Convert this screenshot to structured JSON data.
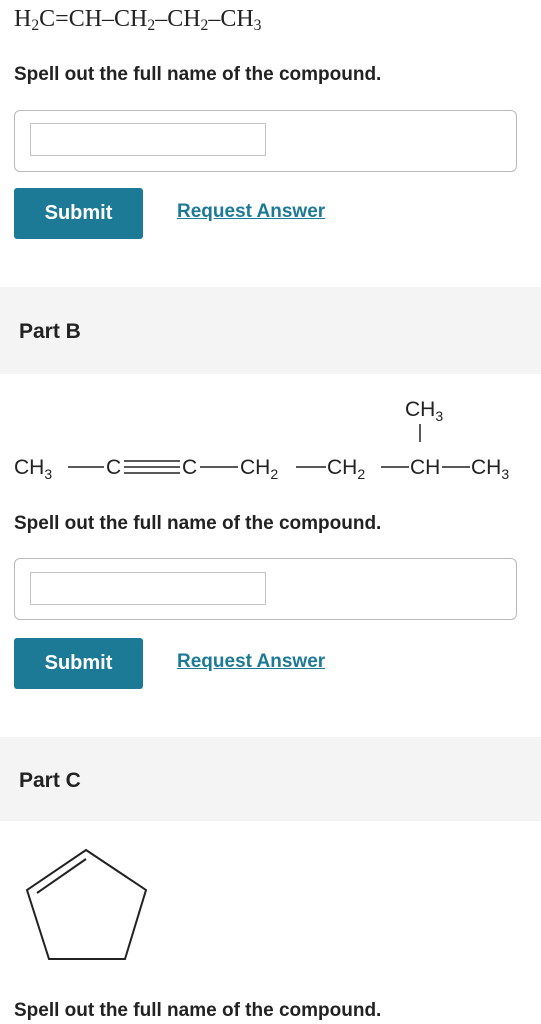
{
  "part_a": {
    "formula": {
      "h2": "H",
      "h2_sub": "2",
      "c": "C",
      "eq": "=",
      "ch": "CH",
      "dash1": "–",
      "ch2a": "CH",
      "ch2a_sub": "2",
      "dash2": "–",
      "ch2b": "CH",
      "ch2b_sub": "2",
      "dash3": "–",
      "ch3": "CH",
      "ch3_sub": "3"
    },
    "prompt": "Spell out the full name of the compound.",
    "input_value": "",
    "submit_label": "Submit",
    "request_label": "Request Answer"
  },
  "part_b": {
    "title": "Part B",
    "structure": {
      "branch_ch": "CH",
      "branch_sub": "3",
      "c1": "CH",
      "c1_sub": "3",
      "c2": "C",
      "c3": "C",
      "c4": "CH",
      "c4_sub": "2",
      "c5": "CH",
      "c5_sub": "2",
      "c6": "CH",
      "c7": "CH",
      "c7_sub": "3"
    },
    "prompt": "Spell out the full name of the compound.",
    "input_value": "",
    "submit_label": "Submit",
    "request_label": "Request Answer"
  },
  "part_c": {
    "title": "Part C",
    "prompt": "Spell out the full name of the compound."
  },
  "colors": {
    "accent": "#1d7a97",
    "header_bg": "#f4f4f4",
    "text": "#222222"
  }
}
